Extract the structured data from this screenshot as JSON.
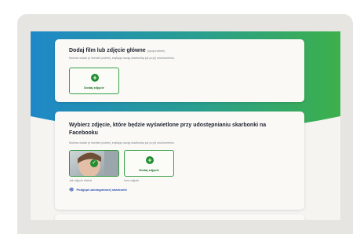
{
  "section_main": {
    "title": "Dodaj film lub zdjęcie główne",
    "optional": "(opcjonalnie)",
    "hint": "Możesz dodać je również później, edytując swoją skarbonkę już po jej uruchomieniu.",
    "add_label": "Dodaj zdjęcie"
  },
  "section_share": {
    "title": "Wybierz zdjęcie, które będzie wyświetlone przy udostępnianiu skarbonki na Facebooku",
    "hint": "Możesz dodać je również później, edytując swoją skarbonkę już po jej uruchomieniu.",
    "add_label": "Dodaj zdjęcie",
    "caption_selected": "Jak zdjęcie zbiórki",
    "caption_other": "Inne zdjęcie",
    "preview_link": "Podgląd udostępnionej skarbonki"
  },
  "colors": {
    "accent_green": "#1e8e2e",
    "hero_blue": "#1e88c8",
    "hero_green": "#3cb04a",
    "link_blue": "#2c4fb0"
  },
  "icons": [
    "plus-icon",
    "check-icon",
    "eye-icon"
  ]
}
